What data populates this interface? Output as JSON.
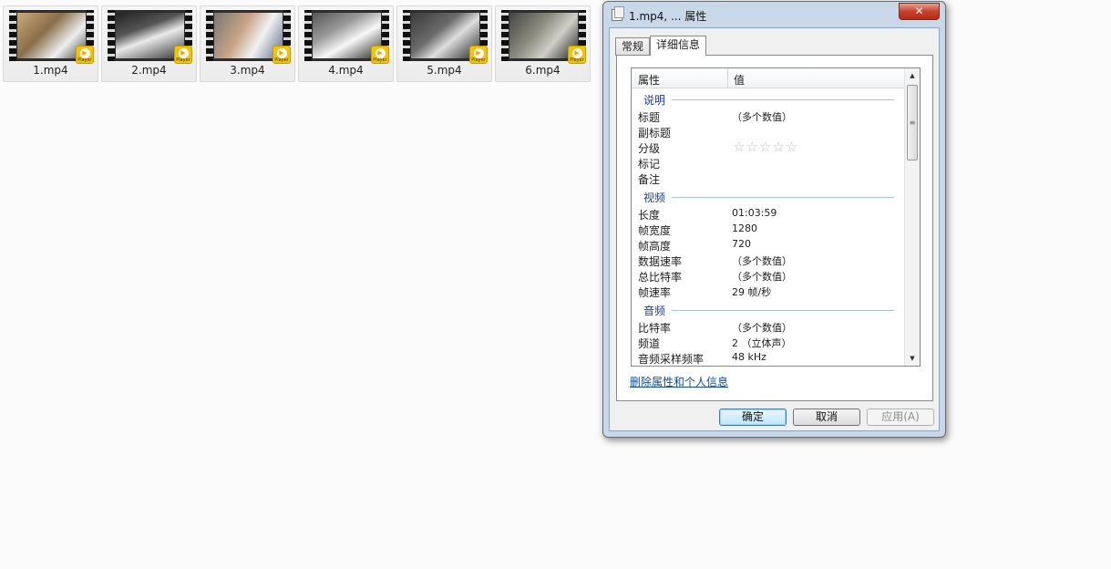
{
  "files": [
    {
      "name": "1.mp4",
      "badge": "Player"
    },
    {
      "name": "2.mp4",
      "badge": "Player"
    },
    {
      "name": "3.mp4",
      "badge": "Player"
    },
    {
      "name": "4.mp4",
      "badge": "Player"
    },
    {
      "name": "5.mp4",
      "badge": "Player"
    },
    {
      "name": "6.mp4",
      "badge": "Player"
    }
  ],
  "dialog": {
    "title": "1.mp4, ... 属性",
    "close_glyph": "✕",
    "tabs": [
      "常规",
      "详细信息"
    ],
    "columns": {
      "property": "属性",
      "value": "值"
    },
    "sections": {
      "description": "说明",
      "video": "视频",
      "audio": "音频"
    },
    "description_rows": [
      {
        "key": "标题",
        "value": "（多个数值）"
      },
      {
        "key": "副标题",
        "value": ""
      },
      {
        "key": "分级",
        "value": "☆☆☆☆☆"
      },
      {
        "key": "标记",
        "value": ""
      },
      {
        "key": "备注",
        "value": ""
      }
    ],
    "video_rows": [
      {
        "key": "长度",
        "value": "01:03:59"
      },
      {
        "key": "帧宽度",
        "value": "1280"
      },
      {
        "key": "帧高度",
        "value": "720"
      },
      {
        "key": "数据速率",
        "value": "（多个数值）"
      },
      {
        "key": "总比特率",
        "value": "（多个数值）"
      },
      {
        "key": "帧速率",
        "value": "29 帧/秒"
      }
    ],
    "audio_rows": [
      {
        "key": "比特率",
        "value": "（多个数值）"
      },
      {
        "key": "频道",
        "value": "2 （立体声）"
      },
      {
        "key": "音频采样频率",
        "value": "48 kHz"
      }
    ],
    "remove_link": "删除属性和个人信息",
    "buttons": {
      "ok": "确定",
      "cancel": "取消",
      "apply": "应用(A)"
    }
  }
}
